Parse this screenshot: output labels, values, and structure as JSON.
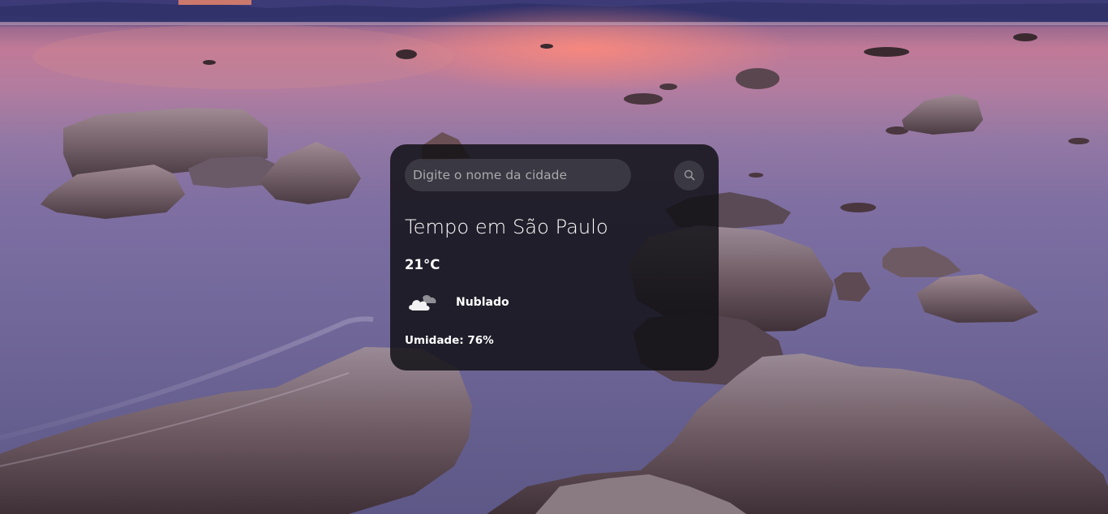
{
  "search": {
    "placeholder": "Digite o nome da cidade",
    "value": "",
    "button_icon": "search-icon"
  },
  "weather": {
    "city_title": "Tempo em São Paulo",
    "temperature": "21°C",
    "condition_icon": "cloud-icon",
    "condition": "Nublado",
    "humidity_label": "Umidade:",
    "humidity_value": "76%"
  },
  "colors": {
    "card_background": "#101014",
    "text": "#ffffff"
  }
}
